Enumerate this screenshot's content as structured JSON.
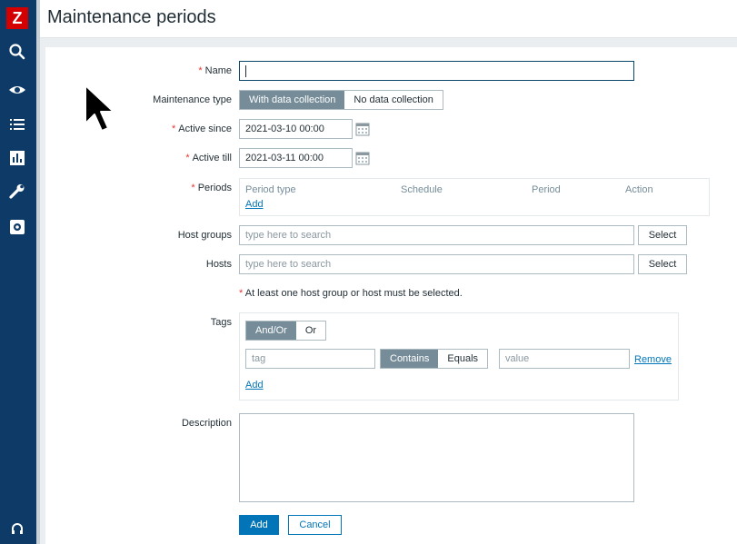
{
  "app": {
    "logo_letter": "Z"
  },
  "sidebar": {
    "items": [
      {
        "icon": "search-icon"
      },
      {
        "icon": "eye-icon"
      },
      {
        "icon": "list-icon"
      },
      {
        "icon": "chart-icon"
      },
      {
        "icon": "wrench-icon"
      },
      {
        "icon": "gear-icon"
      }
    ],
    "bottom_icon": "headset-icon"
  },
  "page": {
    "title": "Maintenance periods"
  },
  "form": {
    "name": {
      "label": "Name",
      "value": ""
    },
    "maintenance_type": {
      "label": "Maintenance type",
      "options": [
        "With data collection",
        "No data collection"
      ],
      "selected": "With data collection"
    },
    "active_since": {
      "label": "Active since",
      "value": "2021-03-10 00:00"
    },
    "active_till": {
      "label": "Active till",
      "value": "2021-03-11 00:00"
    },
    "periods": {
      "label": "Periods",
      "columns": [
        "Period type",
        "Schedule",
        "Period",
        "Action"
      ],
      "add_label": "Add"
    },
    "host_groups": {
      "label": "Host groups",
      "placeholder": "type here to search",
      "button": "Select"
    },
    "hosts": {
      "label": "Hosts",
      "placeholder": "type here to search",
      "button": "Select"
    },
    "host_note": "At least one host group or host must be selected.",
    "tags": {
      "label": "Tags",
      "evaltype_options": [
        "And/Or",
        "Or"
      ],
      "evaltype_selected": "And/Or",
      "tag_placeholder": "tag",
      "operator_options": [
        "Contains",
        "Equals"
      ],
      "operator_selected": "Contains",
      "value_placeholder": "value",
      "remove_label": "Remove",
      "add_label": "Add"
    },
    "description": {
      "label": "Description",
      "value": ""
    },
    "buttons": {
      "add": "Add",
      "cancel": "Cancel"
    }
  },
  "colors": {
    "sidebar": "#0d3a66",
    "logo": "#d40000",
    "primary": "#0275b8",
    "segment_active": "#768d99",
    "required": "#e33734"
  }
}
